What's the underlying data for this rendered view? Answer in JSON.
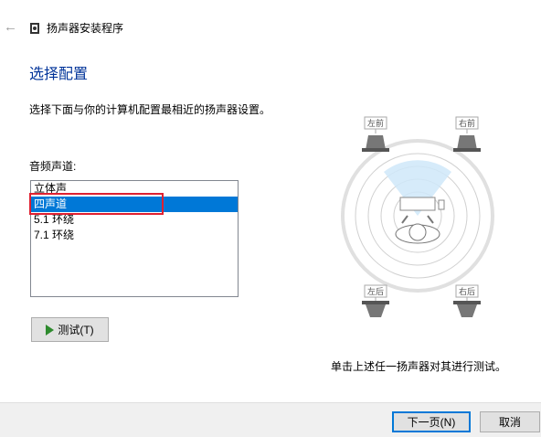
{
  "window": {
    "title": "扬声器安装程序"
  },
  "page": {
    "heading": "选择配置",
    "description": "选择下面与你的计算机配置最相近的扬声器设置。",
    "list_label": "音频声道:",
    "channels": [
      {
        "label": "立体声",
        "selected": false
      },
      {
        "label": "四声道",
        "selected": true
      },
      {
        "label": "5.1 环绕",
        "selected": false
      },
      {
        "label": "7.1 环绕",
        "selected": false
      }
    ],
    "test_button": "测试(T)",
    "hint": "单击上述任一扬声器对其进行测试。"
  },
  "speakers": {
    "front_left": "左前",
    "front_right": "右前",
    "rear_left": "左后",
    "rear_right": "右后"
  },
  "footer": {
    "next_label": "下一页(N)",
    "cancel_label": "取消"
  },
  "colors": {
    "accent": "#0078d7",
    "highlight_border": "#e02030",
    "heading": "#003399",
    "play_icon": "#2e8b2e"
  }
}
